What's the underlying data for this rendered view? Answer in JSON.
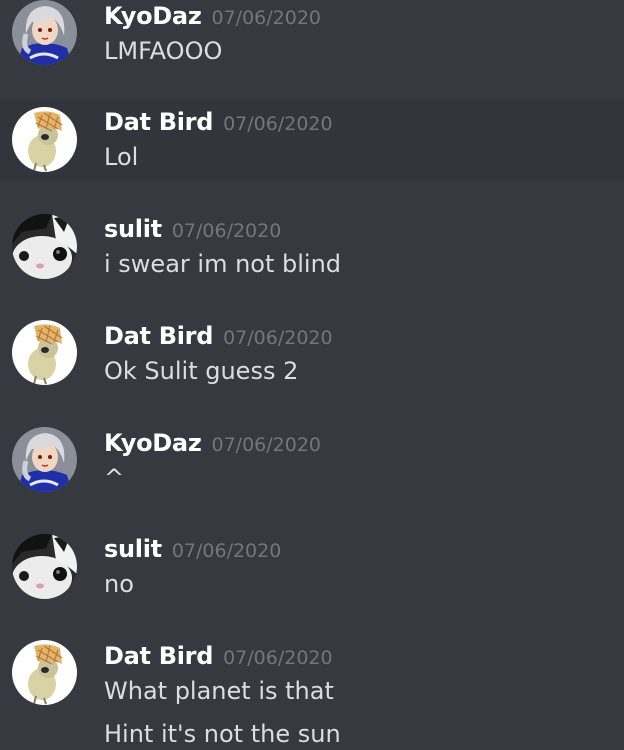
{
  "messages": [
    {
      "author": "KyoDaz",
      "timestamp": "07/06/2020",
      "lines": [
        "LMFAOOO"
      ],
      "avatar": "kyodaz-avatar"
    },
    {
      "author": "Dat Bird",
      "timestamp": "07/06/2020",
      "lines": [
        "Lol"
      ],
      "avatar": "datbird-avatar"
    },
    {
      "author": "sulit",
      "timestamp": "07/06/2020",
      "lines": [
        "i swear im not blind"
      ],
      "avatar": "sulit-avatar"
    },
    {
      "author": "Dat Bird",
      "timestamp": "07/06/2020",
      "lines": [
        "Ok Sulit guess 2"
      ],
      "avatar": "datbird-avatar"
    },
    {
      "author": "KyoDaz",
      "timestamp": "07/06/2020",
      "lines": [
        "^"
      ],
      "avatar": "kyodaz-avatar"
    },
    {
      "author": "sulit",
      "timestamp": "07/06/2020",
      "lines": [
        "no"
      ],
      "avatar": "sulit-avatar"
    },
    {
      "author": "Dat Bird",
      "timestamp": "07/06/2020",
      "lines": [
        "What planet is that",
        "Hint it's not the sun"
      ],
      "avatar": "datbird-avatar"
    }
  ],
  "colors": {
    "background": "#36393f",
    "highlight": "#32353b",
    "username": "#ffffff",
    "timestamp": "#72767d",
    "message_text": "#dcddde"
  }
}
